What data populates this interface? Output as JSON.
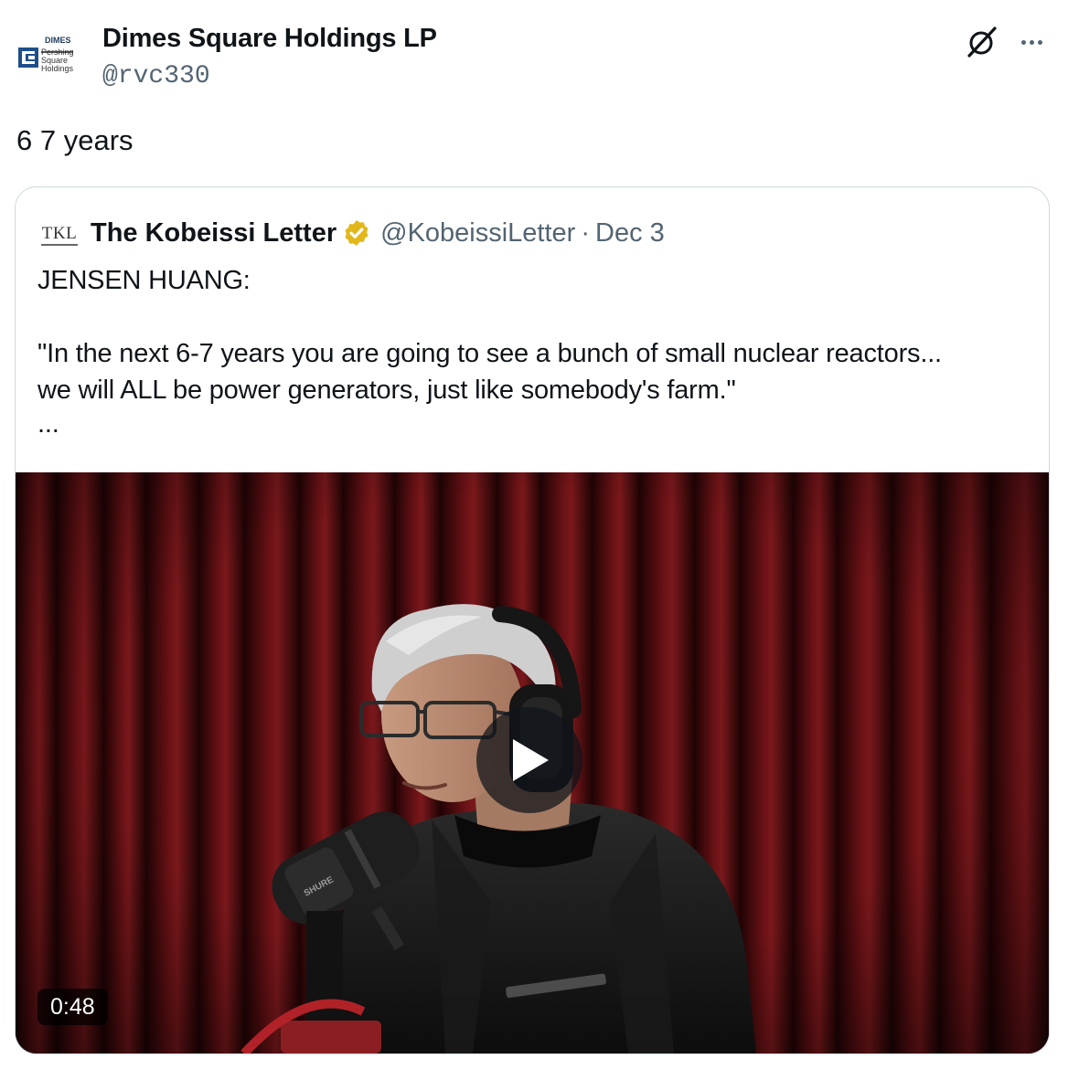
{
  "author": {
    "name": "Dimes Square Holdings LP",
    "handle": "@rvc330",
    "avatar_lines": [
      "DIMES",
      "Pershing",
      "Square",
      "Holdings"
    ]
  },
  "tweet": {
    "text": "6 7 years"
  },
  "quoted": {
    "avatar_text": "TKL",
    "name": "The Kobeissi Letter",
    "handle": "@KobeissiLetter",
    "separator": "·",
    "date": "Dec 3",
    "line1": "JENSEN HUANG:",
    "line2": "\"In the next 6-7 years you are going to see a bunch of small nuclear reactors...",
    "line3": "we will ALL be power generators, just like somebody's farm.\"",
    "more": "...",
    "video": {
      "duration": "0:48",
      "mic_brand": "SHURE"
    }
  },
  "icons": {
    "grok": "grok-icon",
    "more": "more-icon",
    "verified": "verified-badge-icon",
    "play": "play-icon"
  },
  "colors": {
    "verified_gold": "#e2b719",
    "text_primary": "#0f1419",
    "text_secondary": "#536471",
    "card_border": "#cfd9de",
    "curtain": "#4a0a0d"
  }
}
